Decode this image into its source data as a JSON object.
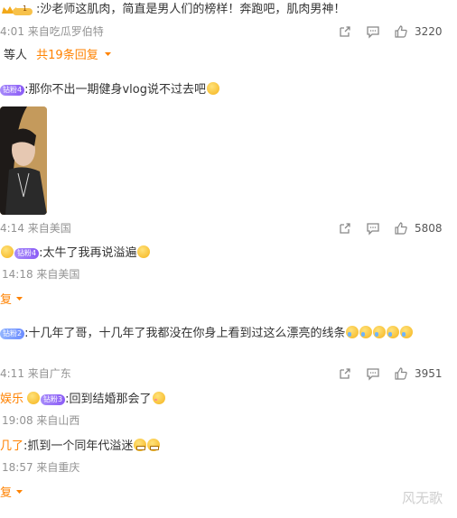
{
  "comments": [
    {
      "text": ":沙老师这肌肉，简直是男人们的榜样！奔跑吧，肌肉男神！",
      "badge": "1",
      "meta": "4:01 来自吃瓜罗伯特",
      "likes": "3220"
    },
    {
      "replies_prefix": "等人",
      "replies_link": "共19条回复"
    },
    {
      "badge": "钻粉4",
      "text": ":那你不出一期健身vlog说不过去吧",
      "meta": "4:14 来自美国",
      "likes": "5808"
    },
    {
      "badge": "钻粉4",
      "text": ":太牛了我再说溢遍",
      "meta": "14:18 来自美国",
      "more": "复"
    },
    {
      "badge": "钻粉2",
      "text": ":十几年了哥，十几年了我都没在你身上看到过这么漂亮的线条",
      "meta": "4:11 来自广东",
      "likes": "3951"
    },
    {
      "name": "娱乐",
      "badge": "钻粉3",
      "text": ":回到结婚那会了",
      "meta": "19:08 来自山西"
    },
    {
      "name": "几了",
      "text": ":抓到一个同年代溢迷",
      "meta": "18:57 来自重庆",
      "more": "复"
    }
  ],
  "watermark": "风无歌",
  "colors": {
    "accent": "#ff8200",
    "meta": "#939393"
  },
  "icons": [
    "share-icon",
    "comment-icon",
    "like-icon",
    "chevron-down-icon"
  ]
}
